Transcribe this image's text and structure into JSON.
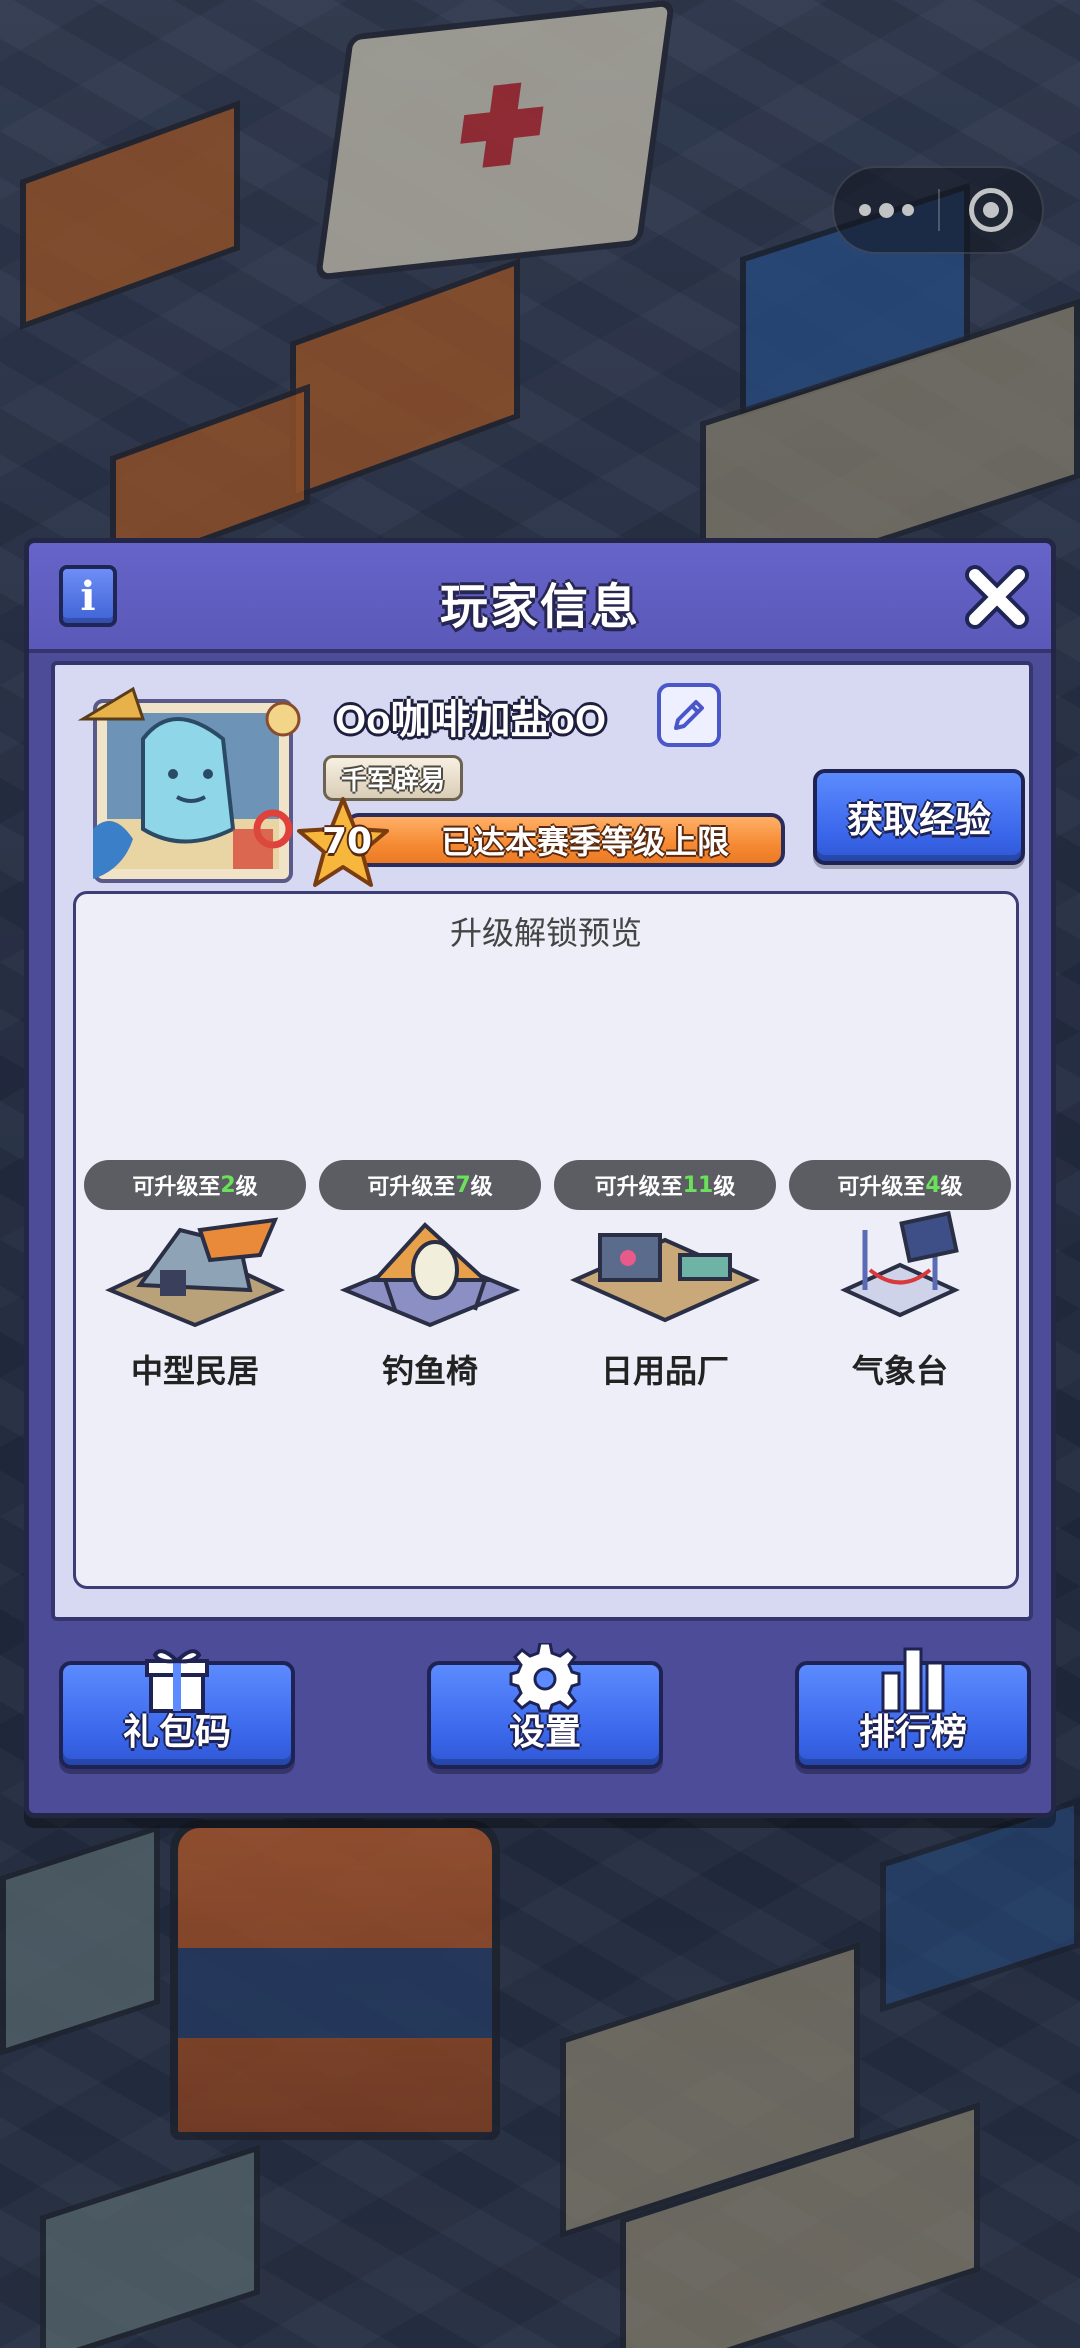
{
  "capsule": {
    "more_icon": "more-dots-icon",
    "close_icon": "target-close-icon"
  },
  "dialog": {
    "title": "玩家信息",
    "info_icon_label": "i",
    "player": {
      "name": "Oo咖啡加盐oO",
      "title_badge": "千军辟易",
      "level": "70",
      "level_status": "已达本赛季等级上限",
      "get_exp_button": "获取经验"
    },
    "preview": {
      "title": "升级解锁预览",
      "items": [
        {
          "badge_prefix": "可升级至",
          "badge_level": "2",
          "badge_suffix": "级",
          "name": "中型民居"
        },
        {
          "badge_prefix": "可升级至",
          "badge_level": "7",
          "badge_suffix": "级",
          "name": "钓鱼椅"
        },
        {
          "badge_prefix": "可升级至",
          "badge_level": "11",
          "badge_suffix": "级",
          "name": "日用品厂"
        },
        {
          "badge_prefix": "可升级至",
          "badge_level": "4",
          "badge_suffix": "级",
          "name": "气象台"
        }
      ]
    },
    "bottom_buttons": {
      "gift_code": "礼包码",
      "settings": "设置",
      "leaderboard": "排行榜"
    }
  },
  "colors": {
    "dialog_bg": "#4c4c98",
    "header_bg": "#6764c9",
    "panel_bg": "#d7d9f3",
    "button_blue": "#3a66ea",
    "level_bar_orange": "#f58a33",
    "level_highlight_green": "#6be05a"
  }
}
